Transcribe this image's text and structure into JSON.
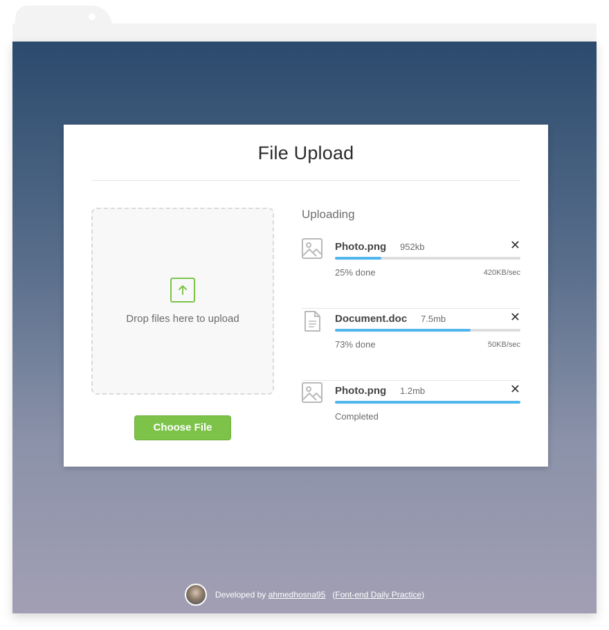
{
  "page": {
    "title": "File Upload",
    "accent_color": "#7dc34a",
    "progress_color": "#4fb6ee"
  },
  "dropzone": {
    "icon": "upload-arrow-icon",
    "text": "Drop files here to upload",
    "button_label": "Choose File"
  },
  "uploads": {
    "heading": "Uploading",
    "items": [
      {
        "icon": "image-file-icon",
        "name": "Photo.png",
        "size": "952kb",
        "progress": 0.25,
        "status": "25% done",
        "speed": "420KB/sec"
      },
      {
        "icon": "document-file-icon",
        "name": "Document.doc",
        "size": "7.5mb",
        "progress": 0.73,
        "status": "73% done",
        "speed": "50KB/sec"
      },
      {
        "icon": "image-file-icon",
        "name": "Photo.png",
        "size": "1.2mb",
        "progress": 1.0,
        "status": "Completed",
        "speed": ""
      }
    ]
  },
  "footer": {
    "prefix": "Developed by",
    "author": "ahmedhosna95",
    "project_open": "(",
    "project": "Font-end Daily Practice",
    "project_close": ")"
  }
}
